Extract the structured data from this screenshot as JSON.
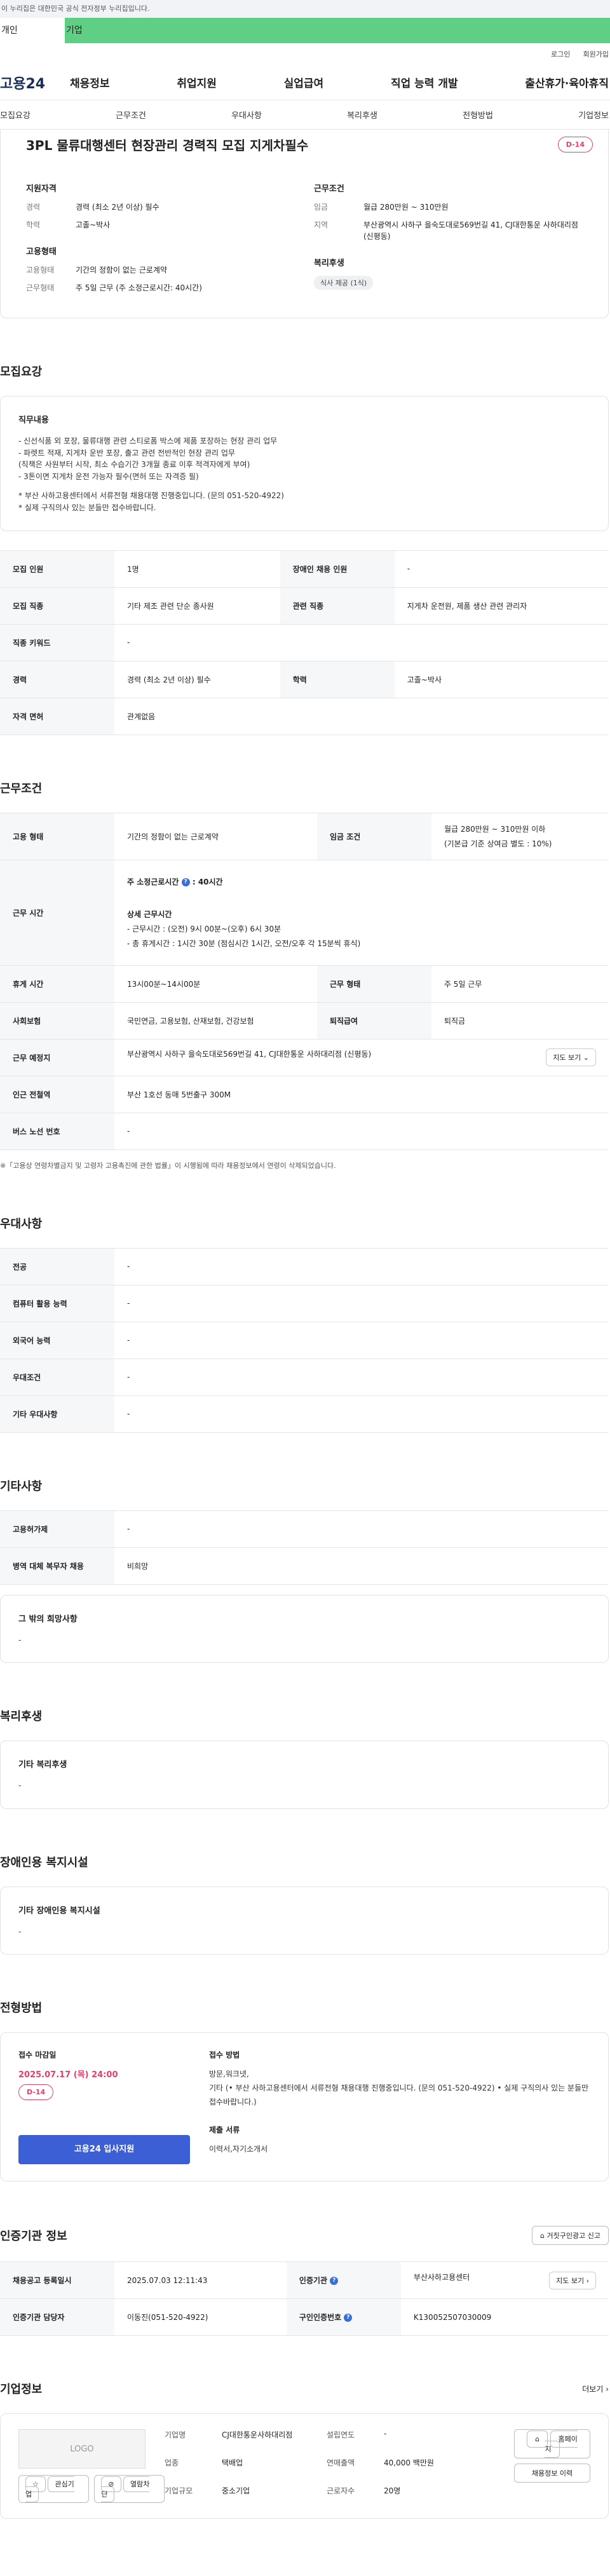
{
  "gov_bar": "이 누리집은 대한민국 공식 전자정부 누리집입니다.",
  "tabs": {
    "personal": "개인",
    "company": "기업"
  },
  "util": {
    "login": "로그인",
    "signup": "회원가입"
  },
  "logo": "고용24",
  "gnb": [
    "채용정보",
    "취업지원",
    "실업급여",
    "직업 능력 개발",
    "출산휴가·육아휴직"
  ],
  "anchors": [
    "모집요강",
    "근무조건",
    "우대사항",
    "복리후생",
    "전형방법",
    "기업정보"
  ],
  "summary": {
    "title": "3PL 물류대행센터 현장관리 경력직 모집 지게차필수",
    "dday": "D-14",
    "qual_title": "지원자격",
    "career_k": "경력",
    "career_v": "경력 (최소 2년 이상) 필수",
    "edu_k": "학력",
    "edu_v": "고졸~박사",
    "emp_title": "고용형태",
    "emptype_k": "고용형태",
    "emptype_v": "기간의 정함이 없는 근로계약",
    "worktype_k": "근무형태",
    "worktype_v": "주 5일 근무 (주 소정근로시간: 40시간)",
    "cond_title": "근무조건",
    "wage_k": "임금",
    "wage_v": "월급 280만원 ~ 310만원",
    "region_k": "지역",
    "region_v": "부산광역시 사하구 을숙도대로569번길 41, CJ대한통운 사하대리점 (신평동)",
    "welfare_title": "복리후생",
    "welfare_chip": "식사 제공 (1식)"
  },
  "recruit": {
    "title": "모집요강",
    "duty_title": "직무내용",
    "duty_lines": [
      "- 신선식품 외 포장, 물류대행 관련 스티로폼 박스에 제품 포장하는 현장 관리 업무",
      "- 파렛트 적재, 지게차 운반 포장, 출고 관련 전반적인 현장 관리 업무",
      "  (직책은 사원부터 시작, 최소 수습기간 3개월 종료 이후 적격자에게 부여)",
      "- 3톤이면 지게차 운전 가능자 필수(면허 또는 자격증 필)",
      "",
      "* 부산 사하고용센터에서 서류전형 채용대행 진행중입니다. (문의 051-520-4922)",
      "* 실제 구직의사 있는 분들만 접수바랍니다."
    ],
    "rows": [
      {
        "k1": "모집 인원",
        "v1": "1명",
        "k2": "장애인 채용 인원",
        "v2": "-"
      },
      {
        "k1": "모집 직종",
        "v1": "기타 제조 관련 단순 종사원",
        "k2": "관련 직종",
        "v2": "지게차 운전원, 제품 생산 관련 관리자"
      },
      {
        "k1": "직종 키워드",
        "v1": "-"
      },
      {
        "k1": "경력",
        "v1": "경력 (최소 2년 이상) 필수",
        "k2": "학력",
        "v2": "고졸~박사"
      },
      {
        "k1": "자격 면허",
        "v1": "관계없음"
      }
    ]
  },
  "work": {
    "title": "근무조건",
    "emp_k": "고용 형태",
    "emp_v": "기간의 정함이 없는 근로계약",
    "wage_k": "임금 조건",
    "wage_v1": "월급 280만원 ~ 310만원 이하",
    "wage_v2": "(기본급 기준 상여금 별도 : 10%)",
    "time_k": "근무 시간",
    "time_a": "주 소정근로시간",
    "time_a_val": ": 40시간",
    "time_b": "상세 근무시간",
    "time_b1": "- 근무시간 : (오전) 9시 00분~(오후) 6시 30분",
    "time_b2": "- 총 휴게시간 : 1시간 30분 (점심시간 1시간, 오전/오후 각 15분씩 휴식)",
    "rest_k": "휴게 시간",
    "rest_v": "13시00분~14시00분",
    "form_k": "근무 형태",
    "form_v": "주 5일 근무",
    "ins_k": "사회보험",
    "ins_v": "국민연금, 고용보험, 산재보험, 건강보험",
    "sev_k": "퇴직급여",
    "sev_v": "퇴직금",
    "place_k": "근무 예정지",
    "place_v": "부산광역시 사하구 을숙도대로569번길 41, CJ대한통운 사하대리점 (신평동)",
    "map_btn": "지도 보기",
    "subway_k": "인근 전철역",
    "subway_v": "부산 1호선 동매 5번출구 300M",
    "bus_k": "버스 노선 번호",
    "bus_v": "-",
    "note": "※「고용상 연령차별금지 및 고령자 고용촉진에 관한 법률」이 시행됨에 따라 채용정보에서 연령이 삭제되었습니다."
  },
  "prefer": {
    "title": "우대사항",
    "rows": [
      {
        "k": "전공",
        "v": "-"
      },
      {
        "k": "컴퓨터 활용 능력",
        "v": "-"
      },
      {
        "k": "외국어 능력",
        "v": "-"
      },
      {
        "k": "우대조건",
        "v": "-"
      },
      {
        "k": "기타 우대사항",
        "v": "-"
      }
    ]
  },
  "etc": {
    "title": "기타사항",
    "rows": [
      {
        "k": "고용허가제",
        "v": "-"
      },
      {
        "k": "병역 대체 복무자 채용",
        "v": "비희망"
      }
    ],
    "other_title": "그 밖의 희망사항",
    "other_v": "-"
  },
  "welfare": {
    "title": "복리후생",
    "box_title": "기타 복리후생",
    "box_v": "-"
  },
  "disabled": {
    "title": "장애인용 복지시설",
    "box_title": "기타 장애인용 복지시설",
    "box_v": "-"
  },
  "apply": {
    "title": "전형방법",
    "deadline_lbl": "접수 마감일",
    "deadline": "2025.07.17 (목) 24:00",
    "dday": "D-14",
    "btn": "고용24 입사지원",
    "method_lbl": "접수 방법",
    "method_1": "방문,워크넷,",
    "method_2": "기타 (• 부산 사하고용센터에서 서류전형 채용대행 진행중입니다. (문의 051-520-4922) • 실제 구직의사 있는 분들만 접수바랍니다.)",
    "docs_lbl": "제출 서류",
    "docs": "이력서,자기소개서"
  },
  "agency": {
    "title": "인증기관 정보",
    "report_btn": "거짓구인광고 신고",
    "reg_k": "채용공고 등록일시",
    "reg_v": "2025.07.03 12:11:43",
    "org_k": "인증기관",
    "org_v": "부산사하고용센터",
    "map_btn": "지도 보기",
    "mgr_k": "인증기관 담당자",
    "mgr_v": "이동진(051-520-4922)",
    "num_k": "구인인증번호",
    "num_v": "K130052507030009"
  },
  "company": {
    "title": "기업정보",
    "more": "더보기",
    "logo": "LOGO",
    "fav_btn": "관심기업",
    "block_btn": "열람차단",
    "name_k": "기업명",
    "name_v": "CJ대한통운사하대리점",
    "year_k": "설립연도",
    "year_v": "-",
    "ind_k": "업종",
    "ind_v": "택배업",
    "sales_k": "연매출액",
    "sales_v": "40,000 백만원",
    "size_k": "기업규모",
    "size_v": "중소기업",
    "emp_k": "근로자수",
    "emp_v": "20명",
    "home_btn": "홈페이지",
    "jobs_btn": "채용정보 이력"
  }
}
